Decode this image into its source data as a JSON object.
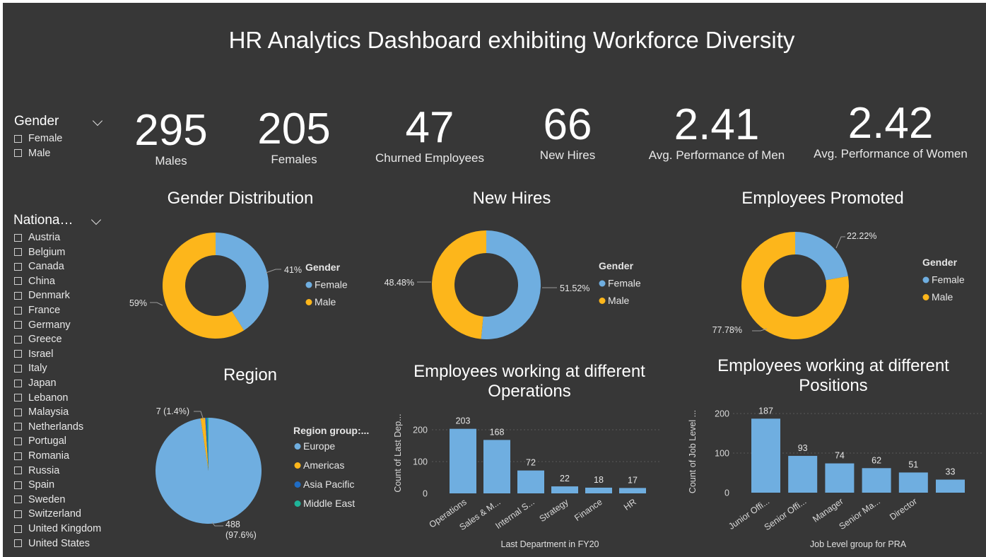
{
  "title": "HR Analytics Dashboard exhibiting Workforce Diversity",
  "kpis": [
    {
      "value": "295",
      "label": "Males"
    },
    {
      "value": "205",
      "label": "Females"
    },
    {
      "value": "47",
      "label": "Churned Employees"
    },
    {
      "value": "66",
      "label": "New Hires"
    },
    {
      "value": "2.41",
      "label": "Avg. Performance of Men"
    },
    {
      "value": "2.42",
      "label": "Avg. Performance of Women"
    }
  ],
  "slicers": {
    "gender": {
      "title": "Gender",
      "items": [
        "Female",
        "Male"
      ]
    },
    "nationality": {
      "title": "Nationa…",
      "items": [
        "Austria",
        "Belgium",
        "Canada",
        "China",
        "Denmark",
        "France",
        "Germany",
        "Greece",
        "Israel",
        "Italy",
        "Japan",
        "Lebanon",
        "Malaysia",
        "Netherlands",
        "Portugal",
        "Romania",
        "Russia",
        "Spain",
        "Sweden",
        "Switzerland",
        "United Kingdom",
        "United States"
      ]
    }
  },
  "colors": {
    "female": "#6FAEE0",
    "male": "#FDB61B",
    "europe": "#6FAEE0",
    "americas": "#FDB61B",
    "asia_pacific": "#1F6CC4",
    "middle_east": "#1FB499",
    "bar": "#6FAEE0",
    "background": "#373737"
  },
  "chart_data": [
    {
      "type": "pie",
      "variant": "donut",
      "title": "Gender Distribution",
      "legend_title": "Gender",
      "slices": [
        {
          "label": "Female",
          "value": 41,
          "display": "41%"
        },
        {
          "label": "Male",
          "value": 59,
          "display": "59%"
        }
      ]
    },
    {
      "type": "pie",
      "variant": "donut",
      "title": "New Hires",
      "legend_title": "Gender",
      "slices": [
        {
          "label": "Female",
          "value": 51.52,
          "display": "51.52%"
        },
        {
          "label": "Male",
          "value": 48.48,
          "display": "48.48%"
        }
      ]
    },
    {
      "type": "pie",
      "variant": "donut",
      "title": "Employees Promoted",
      "legend_title": "Gender",
      "slices": [
        {
          "label": "Female",
          "value": 22.22,
          "display": "22.22%"
        },
        {
          "label": "Male",
          "value": 77.78,
          "display": "77.78%"
        }
      ]
    },
    {
      "type": "pie",
      "title": "Region",
      "legend_title": "Region group:...",
      "slices": [
        {
          "label": "Europe",
          "value": 488,
          "display1": "488",
          "display2": "(97.6%)"
        },
        {
          "label": "Americas",
          "value": 7,
          "display1": "7 (1.4%)"
        },
        {
          "label": "Asia Pacific",
          "value": 3
        },
        {
          "label": "Middle East",
          "value": 2
        }
      ]
    },
    {
      "type": "bar",
      "title": [
        "Employees working at different",
        "Operations"
      ],
      "xlabel": "Last Department in FY20",
      "ylabel": "Count of Last Dep...",
      "categories": [
        "Operations",
        "Sales & M...",
        "Internal S...",
        "Strategy",
        "Finance",
        "HR"
      ],
      "values": [
        203,
        168,
        72,
        22,
        18,
        17
      ],
      "ylim": [
        0,
        240
      ],
      "yticks": [
        0,
        100,
        200
      ]
    },
    {
      "type": "bar",
      "title": [
        "Employees working at different",
        "Positions"
      ],
      "xlabel": "Job Level group for PRA",
      "ylabel": "Count of Job Level ...",
      "categories": [
        "Junior Offi...",
        "Senior Offi...",
        "Manager",
        "Senior Ma...",
        "Director"
      ],
      "values": [
        187,
        93,
        74,
        62,
        51,
        33
      ],
      "ylim": [
        0,
        220
      ],
      "yticks": [
        0,
        100,
        200
      ]
    }
  ]
}
